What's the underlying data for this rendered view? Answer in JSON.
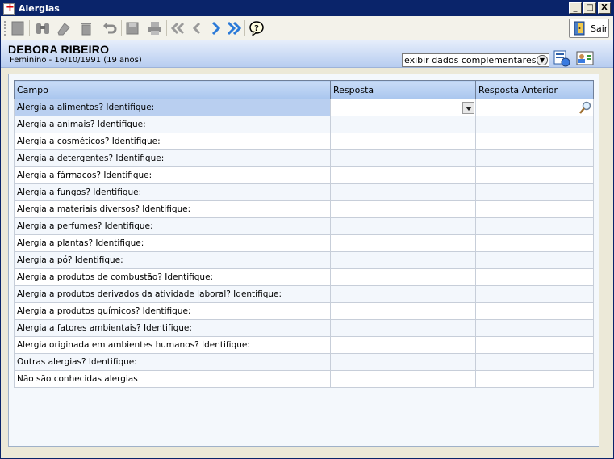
{
  "window": {
    "title": "Alergias",
    "controls": [
      "_",
      "□",
      "X"
    ]
  },
  "toolbar": {
    "icons": [
      "new-icon",
      "find-binoculars-icon",
      "edit-eraser-icon",
      "delete-trash-icon",
      "undo-icon",
      "save-disk-icon",
      "print-icon",
      "first-record-icon",
      "previous-record-icon",
      "next-record-icon",
      "last-record-icon",
      "help-icon"
    ],
    "exit_label": "Sair"
  },
  "patient": {
    "name": "DEBORA RIBEIRO",
    "info": "Feminino - 16/10/1991 (19 anos)",
    "extra_label": "exibir dados complementares..."
  },
  "grid": {
    "columns": [
      "Campo",
      "Resposta",
      "Resposta Anterior"
    ],
    "rows": [
      "Alergia a alimentos? Identifique:",
      "Alergia a animais? Identifique:",
      "Alergia a cosméticos? Identifique:",
      "Alergia a detergentes? Identifique:",
      "Alergia a fármacos? Identifique:",
      "Alergia a fungos? Identifique:",
      "Alergia a materiais diversos? Identifique:",
      "Alergia a perfumes? Identifique:",
      "Alergia a plantas? Identifique:",
      "Alergia a pó? Identifique:",
      "Alergia a produtos de combustão? Identifique:",
      "Alergia a produtos derivados da atividade laboral? Identifique:",
      "Alergia a produtos químicos? Identifique:",
      "Alergia a fatores ambientais? Identifique:",
      "Alergia originada em ambientes humanos? Identifique:",
      "Outras alergias? Identifique:",
      "Não são conhecidas alergias"
    ]
  }
}
